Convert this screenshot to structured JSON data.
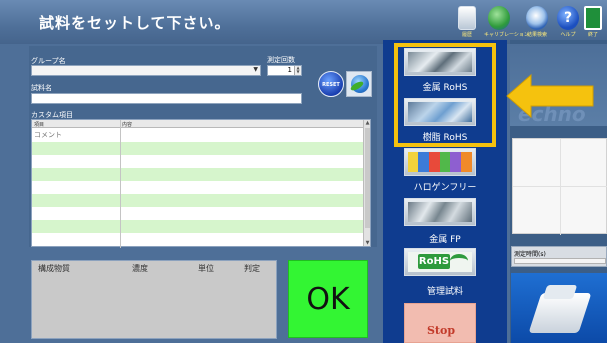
{
  "header": {
    "title": "試料をセットして下さい。",
    "toolbar": [
      {
        "label": "履歴",
        "icon": "history-icon"
      },
      {
        "label": "キャリブレーション",
        "icon": "calibration-icon"
      },
      {
        "label": "結果検索",
        "icon": "result-search-icon"
      },
      {
        "label": "ヘルプ",
        "icon": "help-icon"
      },
      {
        "label": "終了",
        "icon": "exit-icon"
      }
    ]
  },
  "form": {
    "group_label": "グループ名",
    "group_value": "",
    "count_label": "測定回数",
    "count_value": "1",
    "sample_label": "試料名",
    "sample_value": "",
    "custom_label": "カスタム項目",
    "reset_label": "RESET",
    "grid": {
      "col_item": "項目",
      "col_content": "内容",
      "rows": [
        "コメント",
        "",
        "",
        "",
        "",
        "",
        "",
        "",
        ""
      ]
    }
  },
  "results": {
    "headers": [
      "構成物質",
      "濃度",
      "単位",
      "判定"
    ],
    "verdict": "OK"
  },
  "modes": {
    "items": [
      {
        "label": "金属 RoHS"
      },
      {
        "label": "樹脂 RoHS"
      },
      {
        "label": "ハロゲンフリー"
      },
      {
        "label": "金属 FP"
      },
      {
        "label": "管理試料",
        "logo": "RoHS"
      }
    ],
    "stop_label": "Stop"
  },
  "right": {
    "brand": "echno",
    "time_label": "測定時間(s)"
  },
  "colors": {
    "accent_yellow": "#f5c20e",
    "ok_green": "#33f533",
    "panel_blue": "#0f3c8f"
  }
}
